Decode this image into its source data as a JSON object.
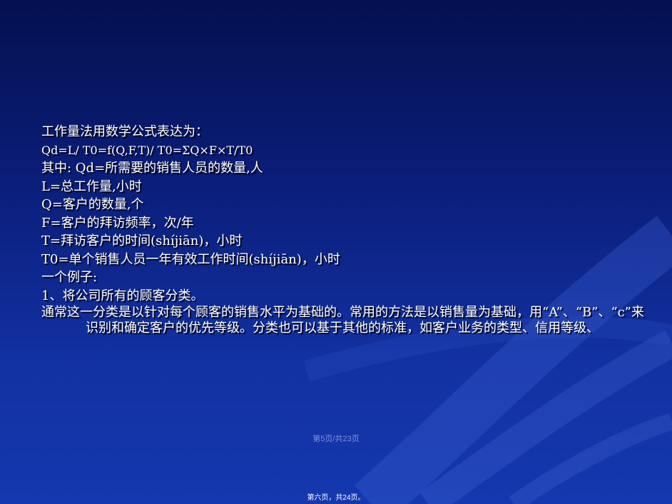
{
  "slide": {
    "lines": [
      "工作量法用数学公式表达为：",
      "Qd=L/ T0=f(Q,F,T)/ T0=ΣQ×F×T/T0",
      "其中: Qd=所需要的销售人员的数量,人",
      "L=总工作量,小时",
      "Q=客户的数量,个",
      "F=客户的拜访频率，次/年",
      "T=拜访客户的时间(shíjiān)，小时",
      "T0=单个销售人员一年有效工作时间(shíjiān)，小时",
      "一个例子:",
      "1、将公司所有的顾客分类。"
    ],
    "paragraph": "通常这一分类是以针对每个顾客的销售水平为基础的。常用的方法是以销售量为基础，用“A”、“B”、“c”来识别和确定客户的优先等级。分类也可以基于其他的标准，如客户业务的类型、信用等级、"
  },
  "page_number": "第5页/共23页",
  "footer": "第六页，共24页。"
}
